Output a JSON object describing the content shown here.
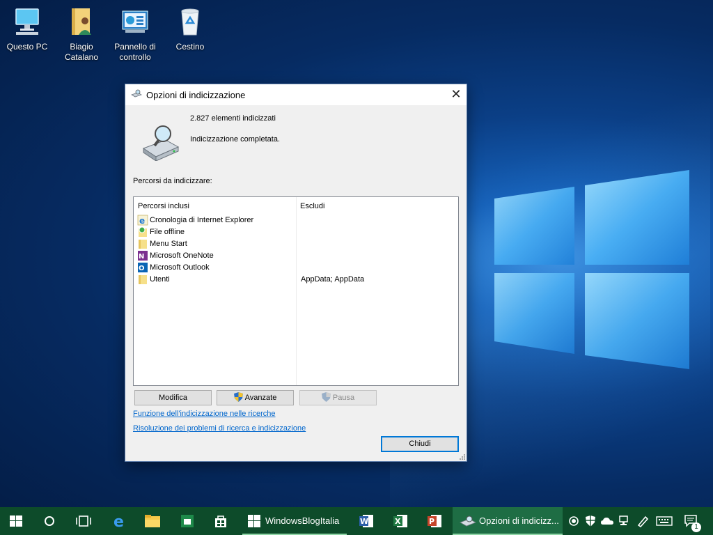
{
  "desktop": {
    "icons": [
      {
        "label": "Questo PC",
        "icon": "computer-icon"
      },
      {
        "label": "Biagio\nCatalano",
        "icon": "user-folder-icon"
      },
      {
        "label": "Pannello di\ncontrollo",
        "icon": "control-panel-icon"
      },
      {
        "label": "Cestino",
        "icon": "recycle-bin-icon"
      }
    ]
  },
  "dialog": {
    "title": "Opzioni di indicizzazione",
    "indexed_count": "2.827 elementi indicizzati",
    "status": "Indicizzazione completata.",
    "section_label": "Percorsi da indicizzare:",
    "columns": {
      "included": "Percorsi inclusi",
      "exclude": "Escludi"
    },
    "rows": [
      {
        "path": "Cronologia di Internet Explorer",
        "exclude": "",
        "icon": "ie-icon"
      },
      {
        "path": "File offline",
        "exclude": "",
        "icon": "offline-files-icon"
      },
      {
        "path": "Menu Start",
        "exclude": "",
        "icon": "folder-icon"
      },
      {
        "path": "Microsoft OneNote",
        "exclude": "",
        "icon": "onenote-icon"
      },
      {
        "path": "Microsoft Outlook",
        "exclude": "",
        "icon": "outlook-icon"
      },
      {
        "path": "Utenti",
        "exclude": "AppData; AppData",
        "icon": "folder-icon"
      }
    ],
    "buttons": {
      "modify": "Modifica",
      "advanced": "Avanzate",
      "pause": "Pausa",
      "close": "Chiudi"
    },
    "links": {
      "search_indexing": "Funzione dell'indicizzazione nelle ricerche",
      "troubleshoot": "Risoluzione dei problemi di ricerca e indicizzazione"
    }
  },
  "taskbar": {
    "apps": [
      {
        "label": "WindowsBlogItalia"
      },
      {
        "label": "Opzioni di indicizz..."
      }
    ],
    "notification_count": "1",
    "accent": "#0d4b2a"
  }
}
